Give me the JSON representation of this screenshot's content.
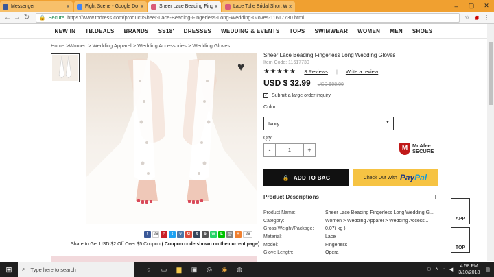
{
  "browser": {
    "tabs": [
      {
        "label": "Messenger",
        "color": "#3b5998",
        "active": false
      },
      {
        "label": "Fight Scene - Google Do",
        "color": "#4285f4",
        "active": false
      },
      {
        "label": "Sheer Lace Beading Fing",
        "color": "#d95b7a",
        "active": true
      },
      {
        "label": "Lace Tulle Bridal Short W",
        "color": "#d95b7a",
        "active": false
      }
    ],
    "secure_label": "Secure",
    "url": "https://www.tbdress.com/product/Sheer-Lace-Beading-Fingerless-Long-Wedding-Gloves-11617730.html"
  },
  "sitenav": [
    "NEW IN",
    "TB.DEALS",
    "BRANDS",
    "SS18'",
    "DRESSES",
    "WEDDING & EVENTS",
    "TOPS",
    "SWIMWEAR",
    "WOMEN",
    "MEN",
    "SHOES"
  ],
  "breadcrumb": {
    "home": "Home >",
    "women": "Women >",
    "apparel": " Wedding Apparel >",
    "accessories": " Wedding Accessories >",
    "current": " Wedding Gloves"
  },
  "share": {
    "count": "26",
    "coupon_prefix": "Share to Get USD $2 Off Over $5 Coupon",
    "coupon_note": "( Coupon code shown on the current page)"
  },
  "product": {
    "title": "Sheer Lace Beading Fingerless Long Wedding Gloves",
    "item_code": "Item Code: 11617730",
    "stars": "★★★★★",
    "rating": 5,
    "reviews_link": "3 Reviews",
    "write_review": "Write a review",
    "price": "USD $ 32.99",
    "old_price": "USD $98.00",
    "bulk": "Submit a large order inquiry",
    "color_label": "Color :",
    "color_value": "Ivory",
    "qty_label": "Qty:",
    "qty_value": "1",
    "mcafee_line1": "McAfee",
    "mcafee_line2": "SECURE",
    "add_to_bag": "ADD TO BAG",
    "checkout_prefix": "Check Out With",
    "paypal_1": "Pay",
    "paypal_2": "Pal",
    "desc_title": "Product Descriptions",
    "desc_toggle": "+",
    "specs": [
      {
        "k": "Product Name:",
        "v": "Sheer Lace Beading Fingerless Long Wedding G..."
      },
      {
        "k": "Category:",
        "v": "Women > Wedding Apparel > Wedding Access..."
      },
      {
        "k": "Gross Weight/Package:",
        "v": "0.07( kg )"
      },
      {
        "k": "Material:",
        "v": "Lace"
      },
      {
        "k": "Model:",
        "v": "Fingerless"
      },
      {
        "k": "Glove Length:",
        "v": "Opera"
      }
    ]
  },
  "side": {
    "app": "APP",
    "top": "TOP"
  },
  "taskbar": {
    "search": "Type here to search",
    "time": "4:58 PM",
    "date": "3/10/2018"
  }
}
